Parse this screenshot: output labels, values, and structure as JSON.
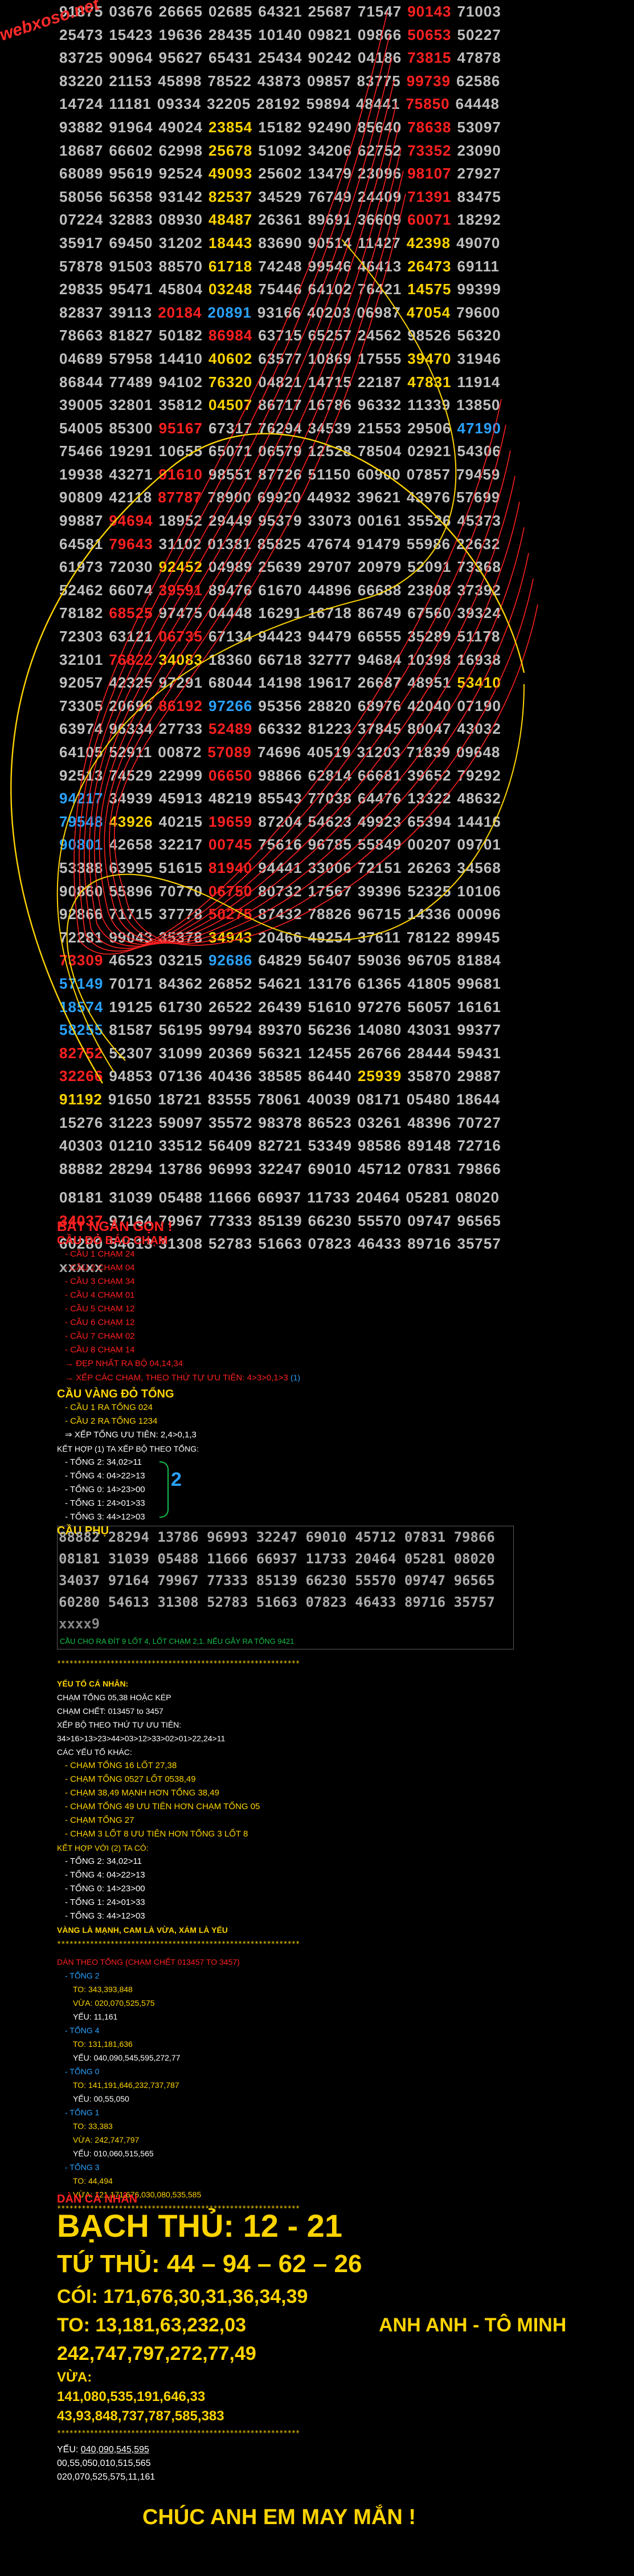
{
  "watermark": "webxoso.net",
  "grid_rows": [
    "91875 03676 26665 02685 64321 25687 71547 90143 71003",
    "25473 15423 19636 28435 10140 09821 09866 50653 50227",
    "83725 90964 95627 65431 25434 90242 04186 73815 47878",
    "83220 21153 45898 78522 43873 09857 83775 99739 62586",
    "14724 11181 09334 32205 28192 59894 48441 75850 64448",
    "93882 91964 49024 23854 15182 92490 85640 78638 53097",
    "18687 66602 62998 25678 51092 34206 62752 73352 23090",
    "68089 95619 92524 49093 25602 13479 23096 98107 27927",
    "58056 56358 93142 82537 34529 76749 24409 71391 83475",
    "07224 32883 08930 48487 26361 89691 36609 60071 18292",
    "35917 69450 31202 18443 83690 90514 11427 42398 49070",
    "57878 91503 88570 61718 74248 99546 46413 26473 69111",
    "29835 95471 45804 03248 75446 64102 76421 14575 99399",
    "82837 39113 20184 20891 93166 40203 06987 47054 79600",
    "78663 81827 50182 86984 63715 65257 24562 98526 56320",
    "04689 57958 14410 40602 63577 10869 17555 39470 31946",
    "86844 77489 94102 76320 04821 14715 22187 47831 11914",
    "39005 32801 35812 04507 86717 16786 96332 11339 13850",
    "54005 85300 95167 67317 76294 34539 21553 29506 47190",
    "75466 19291 10655 65071 06579 12528 78504 02921 54306",
    "19938 43271 91610 98551 87726 51150 60900 07857 79459",
    "90809 42118 87787 78900 69920 44932 39621 43976 57699",
    "99887 94694 18952 29449 95379 33073 00161 35526 45373",
    "64581 79643 31102 01381 85825 47674 91479 55986 22632",
    "61973 72030 92452 04989 25639 29707 20979 52091 73368",
    "52462 66074 39591 89476 61670 44896 66688 23808 37392",
    "78182 68525 97475 04448 16291 16718 86749 67560 39324",
    "72303 63121 06735 67134 94423 94479 66555 35289 51178",
    "32101 76822 34083 18360 66718 32777 94684 10398 16938",
    "92057 42325 97291 68044 14198 19617 26687 48951 53410",
    "73305 20696 86192 97266 95356 28820 68976 42040 07190",
    "63974 96334 27733 52489 66332 81223 37845 80047 43032",
    "64105 52911 00872 57089 74696 40519 31203 71839 09648",
    "92513 74529 22999 06650 98866 62814 66681 39652 79292",
    "94217 34939 45913 48219 85543 77038 64476 13322 48632",
    "79548 43926 40215 19659 87204 54623 49923 65394 14416",
    "90801 42658 32217 00745 75616 96785 55849 00207 09701",
    "53388 63995 51615 81940 94441 33006 72151 26263 34568",
    "90860 55896 70770 06750 80732 17567 39396 52325 10106",
    "92866 71715 37778 50275 87432 78826 96715 14336 00096",
    "72281 99043 35378 34943 20466 49254 37611 78122 89945",
    "73309 46523 03215 92686 64829 56407 59036 96705 81884",
    "57149 70171 84362 26852 54621 13176 61365 41805 99681",
    "18574 19125 61730 26522 26439 51610 97276 56057 16161",
    "58255 81587 56195 99794 89370 56236 14080 43031 99377",
    "82752 52307 31099 20369 56321 12455 26766 28444 59431",
    "32266 94853 07136 40436 38585 86440 25939 35870 29887",
    "91192 91650 18721 83555 78061 40039 08171 05480 18644",
    "15276 31223 59097 35572 98378 86523 03261 48396 70727",
    "40303 01210 33512 56409 82721 53349 98586 89148 72716",
    "88882 28294 13786 96993 32247 69010 45712 07831 79866",
    "",
    "08181 31039 05488 11666 66937 11733 20464 05281 08020",
    "34037 97164 79967 77333 85139 66230 55570 09747 96565",
    "60280 54613 31308 52783 51663 07823 46433 89716 35757"
  ],
  "highlights": {
    "red": [
      [
        0,
        7
      ],
      [
        1,
        7
      ],
      [
        2,
        7
      ],
      [
        3,
        7
      ],
      [
        4,
        7
      ],
      [
        5,
        7
      ],
      [
        6,
        7
      ],
      [
        7,
        7
      ],
      [
        8,
        7
      ],
      [
        9,
        7
      ],
      [
        13,
        2
      ],
      [
        14,
        3
      ],
      [
        18,
        2
      ],
      [
        20,
        2
      ],
      [
        21,
        2
      ],
      [
        22,
        1
      ],
      [
        23,
        1
      ],
      [
        24,
        2
      ],
      [
        25,
        2
      ],
      [
        26,
        1
      ],
      [
        27,
        2
      ],
      [
        28,
        1
      ],
      [
        30,
        2
      ],
      [
        31,
        3
      ],
      [
        32,
        3
      ],
      [
        33,
        3
      ],
      [
        35,
        3
      ],
      [
        36,
        3
      ],
      [
        37,
        3
      ],
      [
        38,
        3
      ],
      [
        39,
        3
      ],
      [
        40,
        3
      ],
      [
        41,
        0
      ],
      [
        42,
        0
      ],
      [
        43,
        0
      ],
      [
        44,
        0
      ],
      [
        45,
        0
      ],
      [
        46,
        0
      ],
      [
        47,
        0
      ],
      [
        53,
        0
      ]
    ],
    "yel": [
      [
        5,
        3
      ],
      [
        6,
        3
      ],
      [
        7,
        3
      ],
      [
        8,
        3
      ],
      [
        9,
        3
      ],
      [
        10,
        3
      ],
      [
        11,
        3
      ],
      [
        12,
        3
      ],
      [
        15,
        3
      ],
      [
        16,
        3
      ],
      [
        17,
        3
      ],
      [
        24,
        2
      ],
      [
        28,
        2
      ],
      [
        10,
        7
      ],
      [
        11,
        7
      ],
      [
        12,
        7
      ],
      [
        13,
        7
      ],
      [
        15,
        7
      ],
      [
        16,
        7
      ],
      [
        29,
        8
      ],
      [
        35,
        1
      ],
      [
        40,
        3
      ],
      [
        46,
        6
      ],
      [
        47,
        0
      ]
    ],
    "blu": [
      [
        13,
        3
      ],
      [
        18,
        8
      ],
      [
        30,
        3
      ],
      [
        34,
        0
      ],
      [
        35,
        0
      ],
      [
        36,
        0
      ],
      [
        41,
        3
      ],
      [
        42,
        0
      ],
      [
        43,
        0
      ],
      [
        44,
        0
      ]
    ]
  },
  "tail_marker": "xxxxx",
  "sections": {
    "bat_ngan_gon": "BẮT NGẮN GỌN !",
    "cau_do_bao_cham": "CẦU ĐỎ BÁO CHẠM",
    "cau_cham": [
      "CẦU 1 CHẠM 24",
      "CẦU 2 CHẠM 04",
      "CẦU 3 CHẠM 34",
      "CẦU 4 CHẠM 01",
      "CẦU 5 CHẠM 12",
      "CẦU 6 CHẠM 12",
      "CẦU 7 CHẠM 02",
      "CẦU 8 CHẠM 14"
    ],
    "dep_nhat": "ĐẸP NHẤT RA BỘ 04,14,34",
    "xep_cac_cham": "XẾP CÁC CHẠM, THEO THỨ TỰ ƯU TIÊN: 4>3>0,1>3",
    "xep_cac_cham_tag": "(1)",
    "cau_vang_do_tong": "CẦU VÀNG ĐỎ TỔNG",
    "cau_vang": [
      "CẦU 1 RA TỔNG 024",
      "CẦU 2 RA TỔNG 1234"
    ],
    "xep_tong_uu_tien": "XẾP TỔNG ƯU TIÊN: 2,4>0,1,3",
    "ket_hop_1": "KẾT HỢP (1) TA XẾP BỘ THEO TỔNG:",
    "tong_list_1": [
      "TỔNG 2: 34,02>11",
      "TỔNG 4: 04>22>13",
      "TỔNG 0: 14>23>00",
      "TỔNG 1: 24>01>33",
      "TỔNG 3: 44>12>03"
    ],
    "tag_2": "2",
    "cau_phu": "CẦU PHỤ",
    "box_rows": [
      "88882 28294 13786 96993 32247 69010 45712 07831 79866",
      "08181 31039 05488 11666 66937 11733 20464 05281 08020",
      "34037 97164 79967 77333 85139 66230 55570 09747 96565",
      "60280 54613 31308 52783 51663 07823 46433 89716 35757"
    ],
    "box_x": "xxxx9",
    "box_note": "CẦU CHO RA ĐÍT 9 LỐT 4, LỐT CHẠM 2,1. NẾU GÃY RA TỔNG 9421",
    "stars": "***********************************************************",
    "yeu_to_ca_nhan": "YẾU TỐ CÁ NHÂN:",
    "yeu_to_lines": [
      "CHẠM TỔNG 05,38 HOẶC KÉP",
      "CHẠM CHẾT: 013457 to 3457",
      "XẾP BỘ THEO THỨ TỰ ƯU TIÊN:",
      "34>16>13>23>44>03>12>33>02>01>22,24>11",
      "CÁC YẾU TỐ KHÁC:"
    ],
    "yeu_to_list": [
      "CHẠM TỔNG 16 LỐT 27,38",
      "CHẠM TỔNG 0527 LỐT 0538,49",
      "CHẠM 38,49 MẠNH HƠN TỔNG 38,49",
      "CHẠM TỔNG 49 ƯU TIÊN HƠN CHẠM TỔNG 05",
      "CHẠM TỔNG 27",
      "CHẠM 3 LỐT 8 ƯU TIÊN HƠN TỔNG 3 LỐT 8"
    ],
    "ket_hop_2": "KẾT HỢP VỚI (2) TA CÓ:",
    "tong_list_2": [
      "TỔNG 2: 34,02>11",
      "TỔNG 4: 04>22>13",
      "TỔNG 0: 14>23>00",
      "TỔNG 1: 24>01>33",
      "TỔNG 3: 44>12>03"
    ],
    "vang_la_manh": "VÀNG LÀ MẠNH, CAM LÀ VỪA, XÁM LÀ YẾU",
    "dan_theo_tong": "DÀN THEO TỔNG (CHẠM CHẾT 013457 TO 3457)",
    "dan_groups": [
      {
        "label": "TỔNG 2",
        "to": "TO: 343,393,848",
        "vua": "VỪA: 020,070,525,575",
        "yeu": "YẾU: 11,161"
      },
      {
        "label": "TỔNG 4",
        "to": "TO: 131,181,636",
        "vua": "",
        "yeu": "YẾU: 040,090,545,595,272,77"
      },
      {
        "label": "TỔNG 0",
        "to": "TO: 141,191,646,232,737,787",
        "vua": "",
        "yeu": "YẾU: 00,55,050"
      },
      {
        "label": "TỔNG 1",
        "to": "TO: 33,383",
        "vua": "VỪA: 242,747,797",
        "yeu": "YẾU: 010,060,515,565"
      },
      {
        "label": "TỔNG 3",
        "to": "TO: 44,494",
        "vua": "VỪA: 121,171,676,030,080,535,585",
        "yeu": ""
      }
    ],
    "dan_ca_nhan": "DÀN CÁ NHÂN",
    "bach_thu": "BẠCH THỦ: 12 - 21",
    "tu_thu": "TỨ THỦ: 44 – 94 – 62 – 26",
    "coi": "CÓI: 171,676,30,31,36,34,39",
    "to_line1": "TO: 13,181,63,232,03",
    "author": "ANH ANH - TÔ MINH",
    "to_line2": "242,747,797,272,77,49",
    "vua_label": "VỪA:",
    "vua_line1": "141,080,535,191,646,33",
    "vua_line2": "43,93,848,737,787,585,383",
    "yeu_label": "YẾU:",
    "yeu_line1": "040,090,545,595",
    "yeu_line2": "00,55,050,010,515,565",
    "yeu_line3": "020,070,525,575,11,161",
    "chuc": "CHÚC ANH EM MAY MẮN !"
  }
}
